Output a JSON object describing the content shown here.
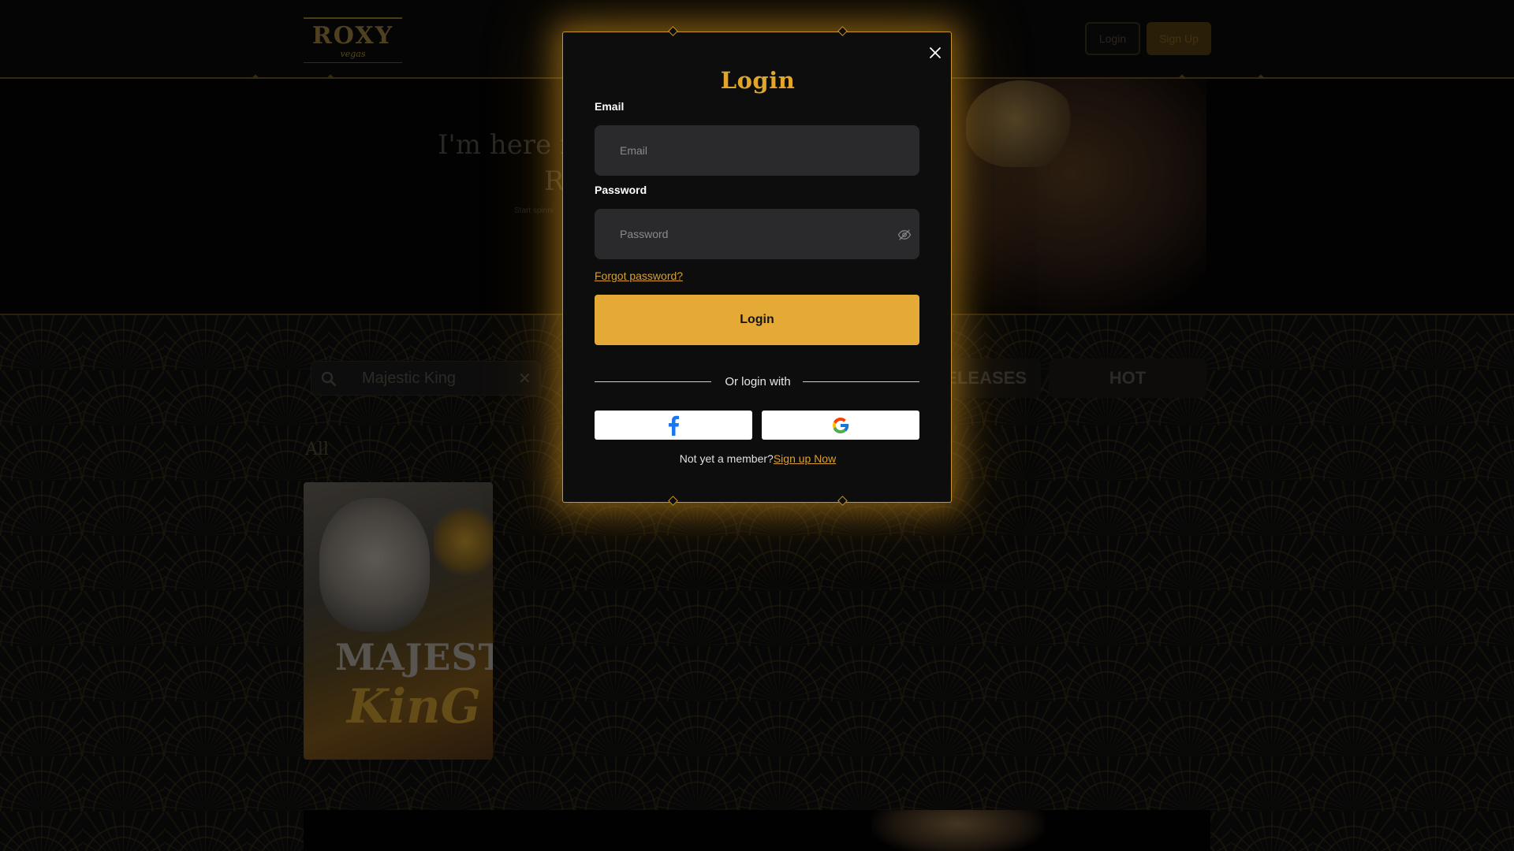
{
  "header": {
    "logo_text": "ROXY",
    "logo_sub": "vegas",
    "login_label": "Login",
    "signup_label": "Sign Up"
  },
  "hero": {
    "title_line1": "I'm here f",
    "title_line2": "R",
    "subtitle": "Start spinni"
  },
  "games": {
    "search_value": "Majestic King",
    "tabs": [
      "ELEASES",
      "HOT"
    ],
    "section_label": "All",
    "card_title1": "MAJEST",
    "card_title2": "KinG"
  },
  "modal": {
    "title": "Login",
    "email_label": "Email",
    "email_placeholder": "Email",
    "password_label": "Password",
    "password_placeholder": "Password",
    "forgot_label": "Forgot password?",
    "submit_label": "Login",
    "divider_text": "Or login with",
    "social": [
      "facebook",
      "google"
    ],
    "signup_prompt": "Not yet a member?",
    "signup_link": "Sign up Now"
  },
  "colors": {
    "accent": "#e5a935",
    "modal_border": "#c8952a",
    "background": "#0d0d0d",
    "input_bg": "#2a2a2c"
  },
  "icons": [
    "close-icon",
    "eye-off-icon",
    "search-icon",
    "facebook-icon",
    "google-icon"
  ]
}
